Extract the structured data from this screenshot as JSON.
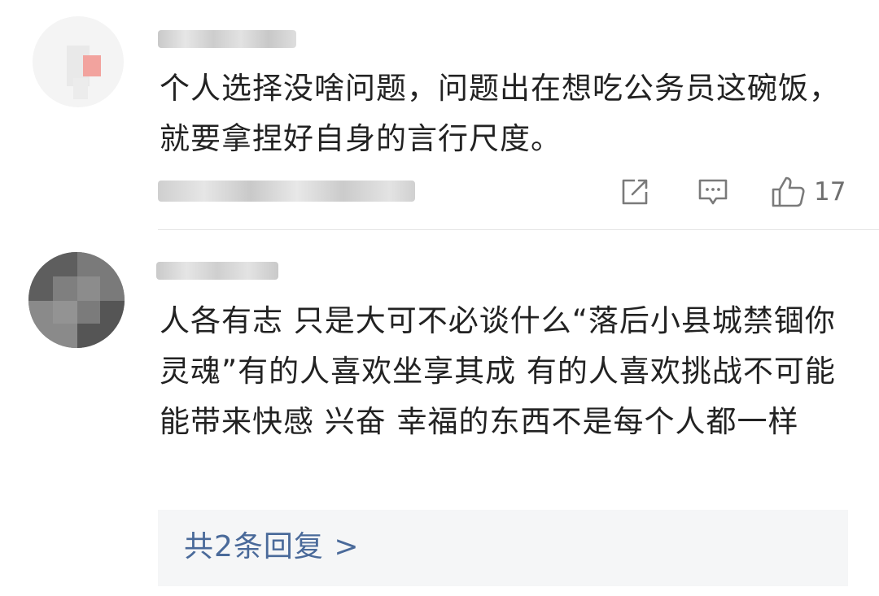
{
  "comments": [
    {
      "text": "个人选择没啥问题，问题出在想吃公务员这碗饭，就要拿捏好自身的言行尺度。",
      "likes": "17",
      "actions": {
        "share_icon": "share-icon",
        "comment_icon": "comment-icon",
        "like_icon": "thumbs-up-icon"
      }
    },
    {
      "text": "人各有志 只是大可不必谈什么“落后小县城禁锢你灵魂”有的人喜欢坐享其成 有的人喜欢挑战不可能 能带来快感 兴奋 幸福的东西不是每个人都一样",
      "replies_label": "共2条回复 >"
    }
  ],
  "colors": {
    "text": "#222222",
    "meta": "#6f6f6f",
    "link": "#4a6a9a",
    "reply_bg": "#f5f6f7",
    "divider": "#e5e5e5"
  }
}
